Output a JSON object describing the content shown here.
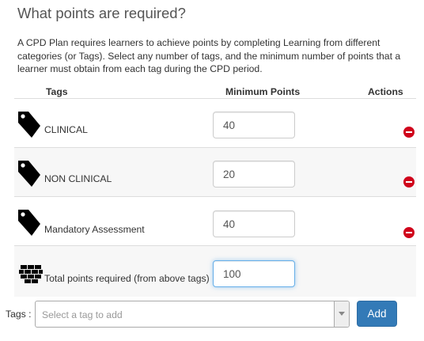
{
  "heading": "What points are required?",
  "description": "A CPD Plan requires learners to achieve points by completing Learning from different categories (or Tags). Select any number of tags, and the minimum number of points that a learner must obtain from each tag during the CPD period.",
  "table": {
    "columns": [
      "Tags",
      "Minimum Points",
      "Actions"
    ],
    "rows": [
      {
        "tag": "CLINICAL",
        "points": "40",
        "icon": "tag-icon",
        "action_icon": "remove-icon"
      },
      {
        "tag": "NON CLINICAL",
        "points": "20",
        "icon": "tag-icon",
        "action_icon": "remove-icon"
      },
      {
        "tag": "Mandatory Assessment",
        "points": "40",
        "icon": "tag-icon",
        "action_icon": "remove-icon"
      }
    ],
    "total": {
      "label": "Total points required (from above tags)",
      "points": "100",
      "icon": "bricks-icon"
    }
  },
  "tag_picker": {
    "label": "Tags :",
    "placeholder": "Select a tag to add",
    "add_label": "Add"
  },
  "colors": {
    "accent": "#337ab7",
    "remove": "#d0021b",
    "focus_border": "#66afe9"
  }
}
